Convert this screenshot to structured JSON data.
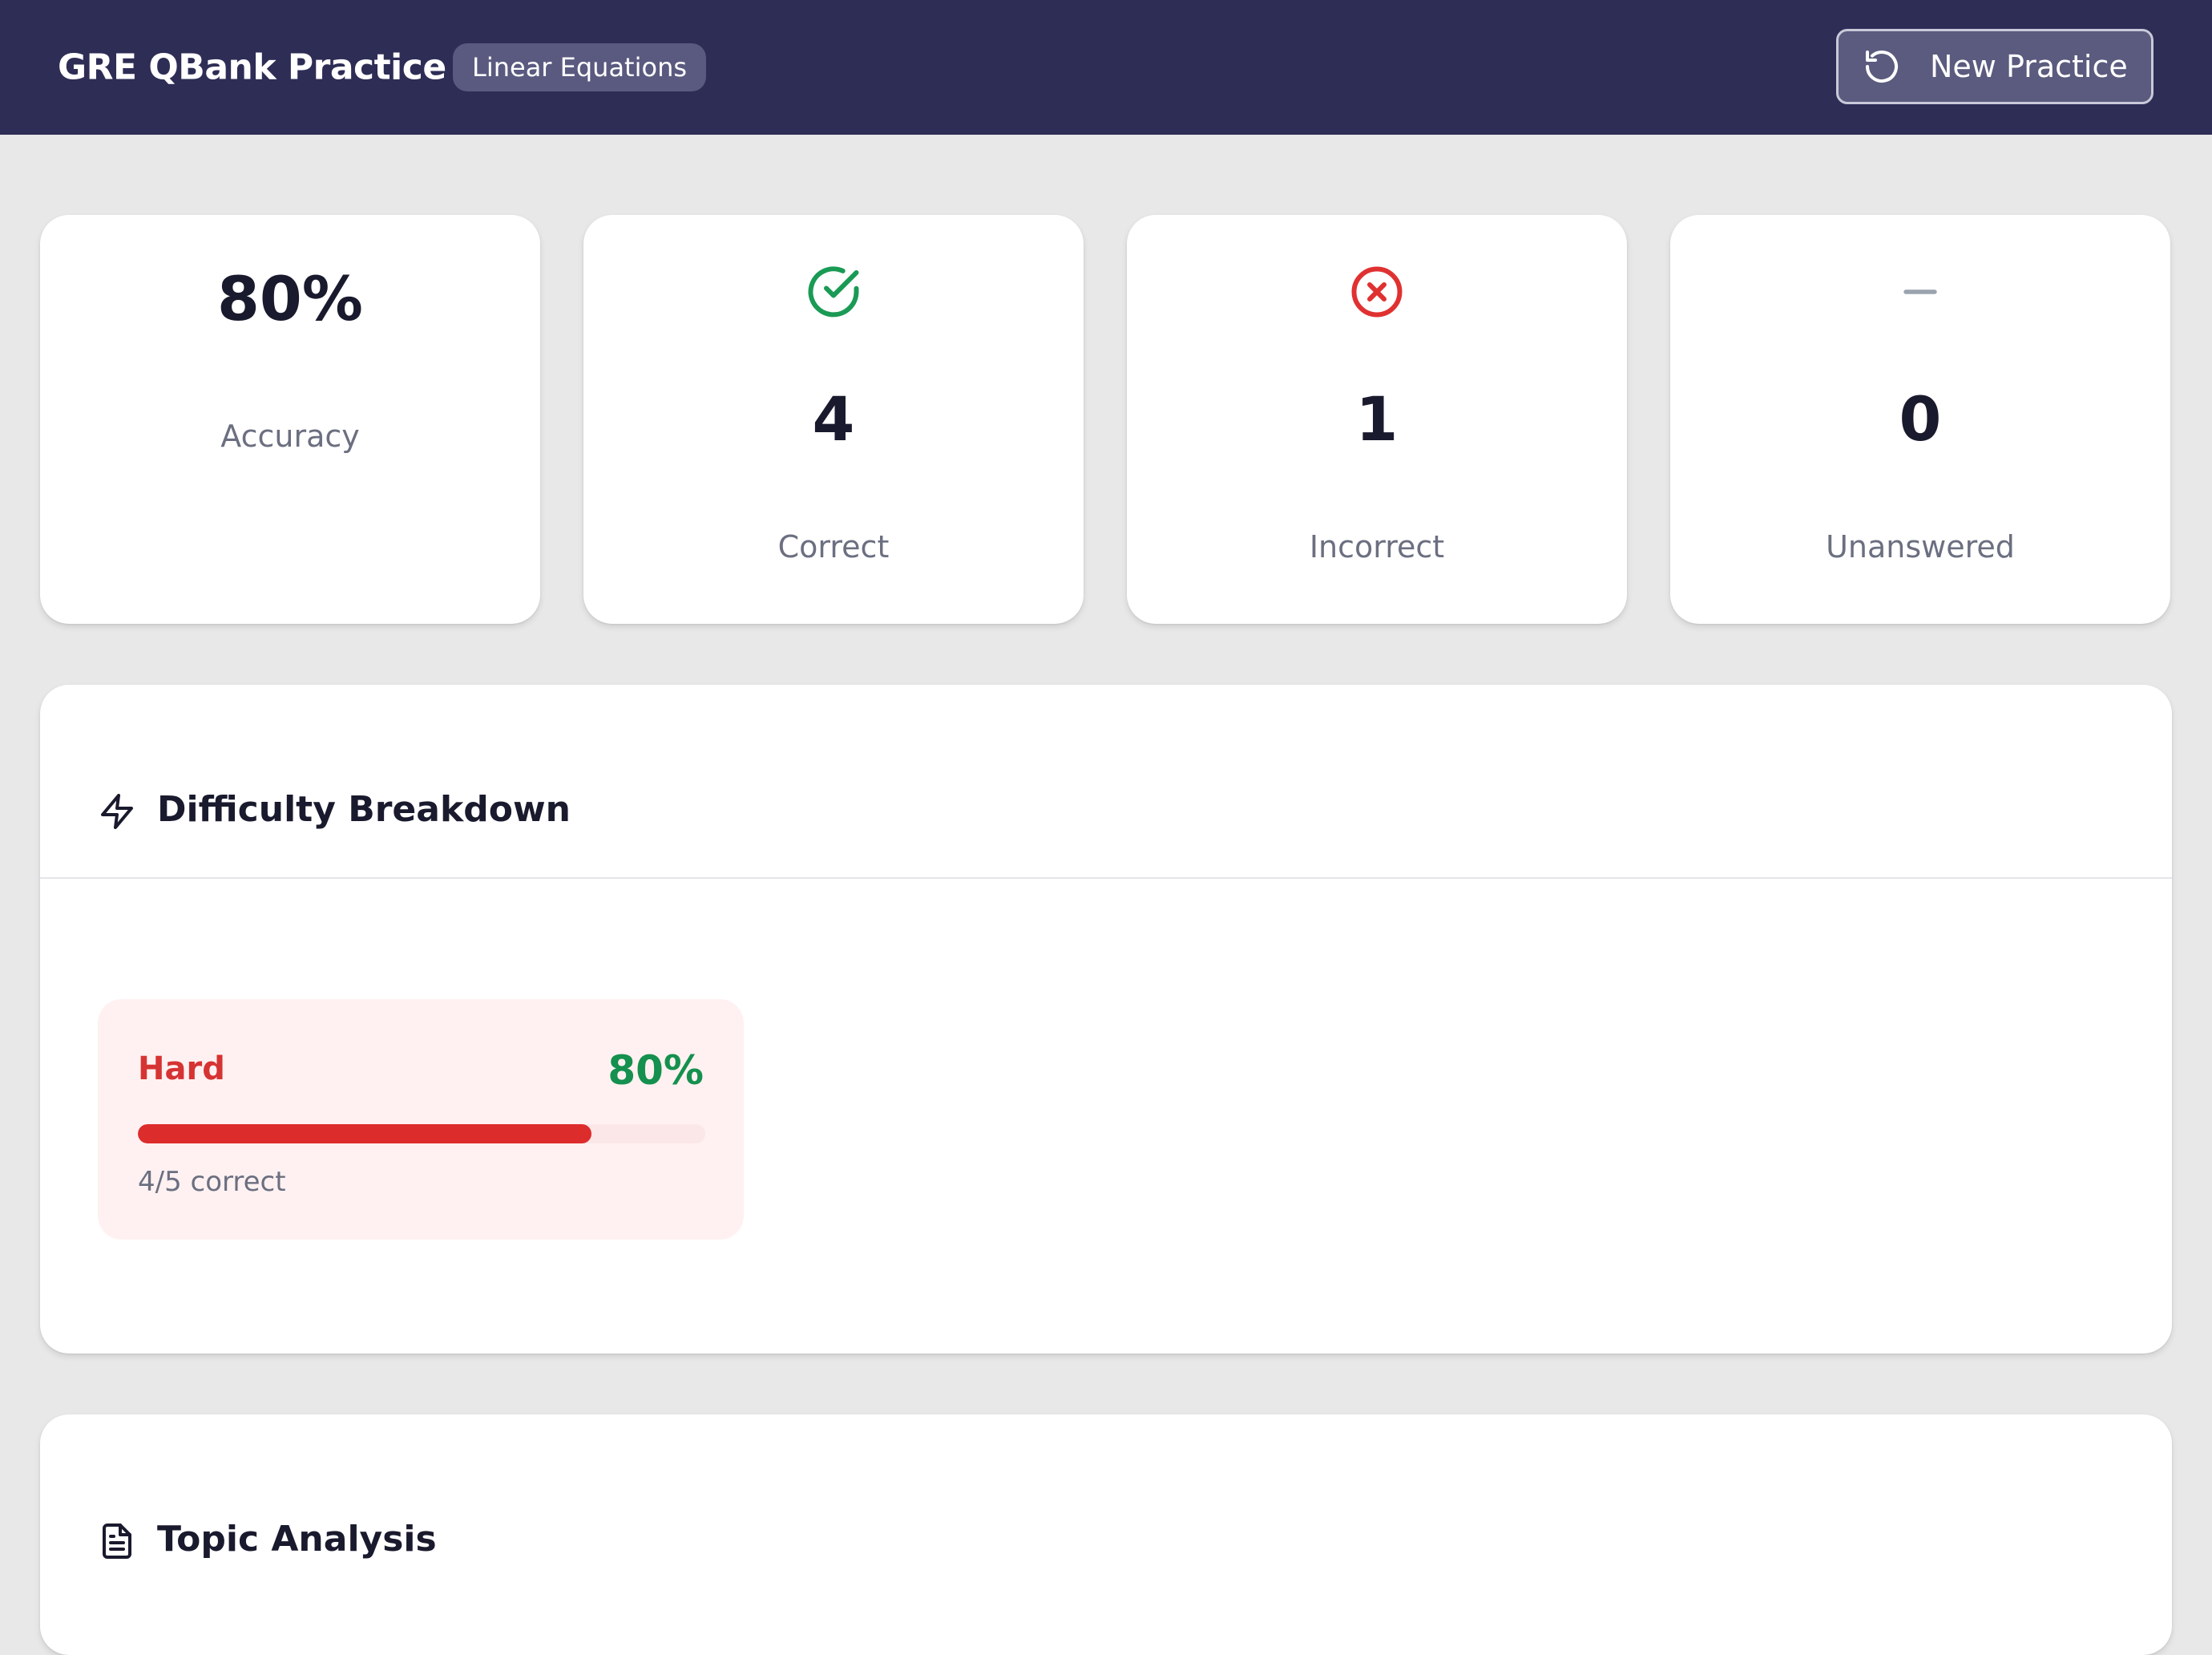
{
  "header": {
    "app_title": "GRE QBank Practice",
    "topic_badge": "Linear Equations",
    "new_practice_label": "New Practice",
    "new_practice_icon": "rotate-ccw-icon",
    "bg_color": "#2e2d56"
  },
  "stats": {
    "accuracy": {
      "value": "80%",
      "label": "Accuracy"
    },
    "correct": {
      "value": "4",
      "label": "Correct",
      "icon": "check-circle-icon",
      "color": "#1a9a55"
    },
    "incorrect": {
      "value": "1",
      "label": "Incorrect",
      "icon": "x-circle-icon",
      "color": "#e03131"
    },
    "unanswered": {
      "value": "0",
      "label": "Unanswered",
      "icon": "dash-icon",
      "color": "#9aa3ad"
    }
  },
  "difficulty": {
    "title": "Difficulty Breakdown",
    "icon": "lightning-icon",
    "items": [
      {
        "name": "Hard",
        "percent_label": "80%",
        "progress": 0.8,
        "detail": "4/5 correct",
        "name_color": "#d63333",
        "percent_color": "#15904e",
        "bar_color": "#dd2c2c"
      }
    ]
  },
  "topics": {
    "title": "Topic Analysis",
    "icon": "document-icon"
  }
}
